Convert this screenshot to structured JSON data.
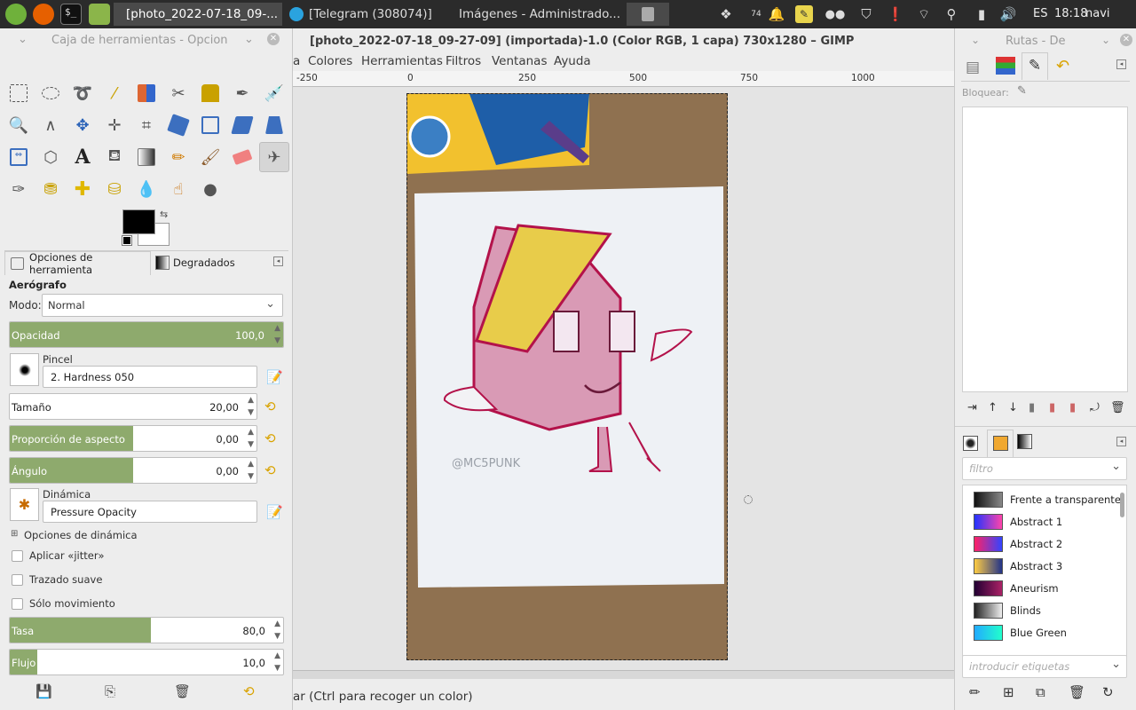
{
  "taskbar": {
    "tasks": [
      {
        "label": "[photo_2022-07-18_09-...",
        "active": true
      },
      {
        "label": "[Telegram (308074)]",
        "active": false
      },
      {
        "label": "Imágenes - Administrado...",
        "active": false
      }
    ],
    "language": "ES",
    "clock": "18:18",
    "user": "navi",
    "badge": "74"
  },
  "window": {
    "title": "[photo_2022-07-18_09-27-09] (importada)-1.0 (Color RGB, 1 capa) 730x1280 – GIMP"
  },
  "menubar": {
    "items": [
      "a",
      "Colores",
      "Herramientas",
      "Filtros",
      "Ventanas",
      "Ayuda"
    ]
  },
  "ruler": {
    "labels": [
      "-250",
      "0",
      "250",
      "500",
      "750",
      "1000"
    ]
  },
  "toolbox": {
    "title": "Caja de herramientas - Opcion"
  },
  "tool_options": {
    "tabs": [
      "Opciones de herramienta",
      "Degradados"
    ],
    "tool_name": "Aerógrafo",
    "mode_label": "Modo:",
    "mode_value": "Normal",
    "opacity": {
      "label": "Opacidad",
      "value": "100,0",
      "fill": 1.0
    },
    "brush_label": "Pincel",
    "brush_value": "2. Hardness 050",
    "size": {
      "label": "Tamaño",
      "value": "20,00",
      "fill": 0.0
    },
    "aspect": {
      "label": "Proporción de aspecto",
      "value": "0,00",
      "fill": 0.5
    },
    "angle": {
      "label": "Ángulo",
      "value": "0,00",
      "fill": 0.5
    },
    "dynamics_label": "Dinámica",
    "dynamics_value": "Pressure Opacity",
    "dynamics_options": "Opciones de dinámica",
    "checkboxes": [
      "Aplicar «jitter»",
      "Trazado suave",
      "Sólo movimiento"
    ],
    "rate": {
      "label": "Tasa",
      "value": "80,0",
      "fill": 0.517
    },
    "flow": {
      "label": "Flujo",
      "value": "10,0",
      "fill": 0.1
    }
  },
  "status_bar": {
    "text": "ar (Ctrl para recoger un color)"
  },
  "right_dock": {
    "title": "Rutas - De",
    "lock_label": "Bloquear:",
    "filter_placeholder": "filtro",
    "tags_placeholder": "introducir etiquetas",
    "gradients": [
      {
        "name": "Frente a transparente",
        "colors": [
          "#111111",
          "#888888"
        ]
      },
      {
        "name": "Abstract 1",
        "colors": [
          "#2233ff",
          "#ff44aa"
        ]
      },
      {
        "name": "Abstract 2",
        "colors": [
          "#ff2266",
          "#3344ff"
        ]
      },
      {
        "name": "Abstract 3",
        "colors": [
          "#ffcc44",
          "#223388"
        ]
      },
      {
        "name": "Aneurism",
        "colors": [
          "#220033",
          "#aa2266"
        ]
      },
      {
        "name": "Blinds",
        "colors": [
          "#222222",
          "#eeeeee"
        ]
      },
      {
        "name": "Blue Green",
        "colors": [
          "#22aaff",
          "#22ffcc"
        ]
      }
    ]
  },
  "image": {
    "watermark": "@MC5PUNK"
  },
  "colors": {
    "accent_green": "#8eaa6d",
    "gimp_yellow": "#d9a300"
  }
}
